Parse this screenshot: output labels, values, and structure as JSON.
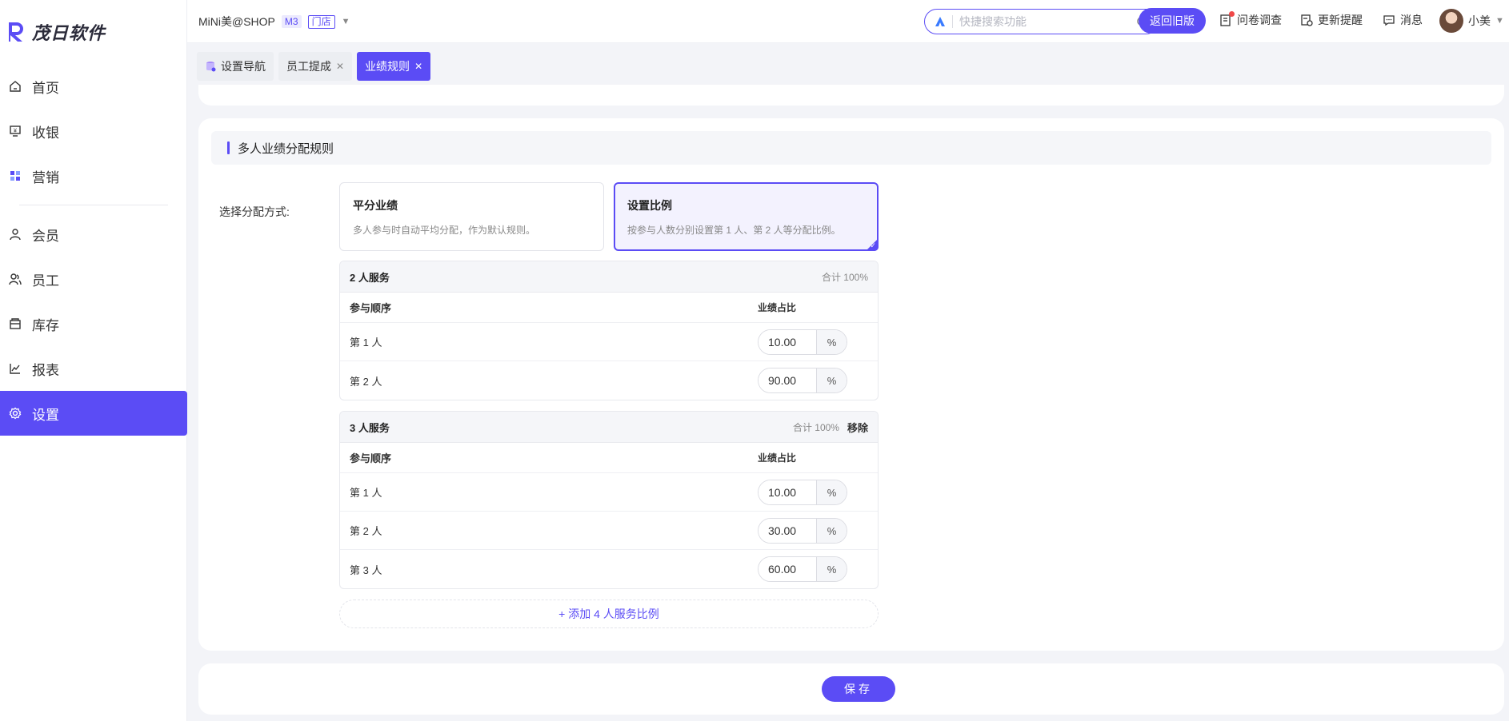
{
  "app": {
    "logo_text": "茂日软件"
  },
  "sidebar": {
    "items": [
      {
        "label": "首页",
        "icon": "home-icon"
      },
      {
        "label": "收银",
        "icon": "cashier-icon"
      },
      {
        "label": "营销",
        "icon": "marketing-icon"
      },
      {
        "label": "会员",
        "icon": "member-icon"
      },
      {
        "label": "员工",
        "icon": "staff-icon"
      },
      {
        "label": "库存",
        "icon": "inventory-icon"
      },
      {
        "label": "报表",
        "icon": "report-icon"
      },
      {
        "label": "设置",
        "icon": "settings-icon",
        "active": true
      }
    ]
  },
  "topbar": {
    "shop_name": "MiNi美@SHOP",
    "plan_badge": "M3",
    "store_badge": "门店",
    "search_placeholder": "快捷搜索功能",
    "old_version_label": "返回旧版",
    "survey_label": "问卷调查",
    "updates_label": "更新提醒",
    "messages_label": "消息",
    "user_name": "小美"
  },
  "tabs": [
    {
      "label": "设置导航",
      "closable": false,
      "active": false
    },
    {
      "label": "员工提成",
      "closable": true,
      "active": false
    },
    {
      "label": "业绩规则",
      "closable": true,
      "active": true
    }
  ],
  "section": {
    "title": "多人业绩分配规则",
    "method_label": "选择分配方式:"
  },
  "options": [
    {
      "title": "平分业绩",
      "desc": "多人参与时自动平均分配，作为默认规则。",
      "selected": false
    },
    {
      "title": "设置比例",
      "desc": "按参与人数分别设置第 1 人、第 2 人等分配比例。",
      "selected": true
    }
  ],
  "groups": [
    {
      "title": "2 人服务",
      "sum": "合计 100%",
      "remove_label": "",
      "col_order": "参与顺序",
      "col_ratio": "业绩占比",
      "rows": [
        {
          "label": "第 1 人",
          "value": "10.00",
          "unit": "%"
        },
        {
          "label": "第 2 人",
          "value": "90.00",
          "unit": "%"
        }
      ]
    },
    {
      "title": "3 人服务",
      "sum": "合计 100%",
      "remove_label": "移除",
      "col_order": "参与顺序",
      "col_ratio": "业绩占比",
      "rows": [
        {
          "label": "第 1 人",
          "value": "10.00",
          "unit": "%"
        },
        {
          "label": "第 2 人",
          "value": "30.00",
          "unit": "%"
        },
        {
          "label": "第 3 人",
          "value": "60.00",
          "unit": "%"
        }
      ]
    }
  ],
  "add_button_label": "+ 添加 4 人服务比例",
  "save_label": "保存",
  "colors": {
    "accent": "#5b4cf5",
    "bg": "#f3f4f8",
    "card": "#ffffff"
  }
}
